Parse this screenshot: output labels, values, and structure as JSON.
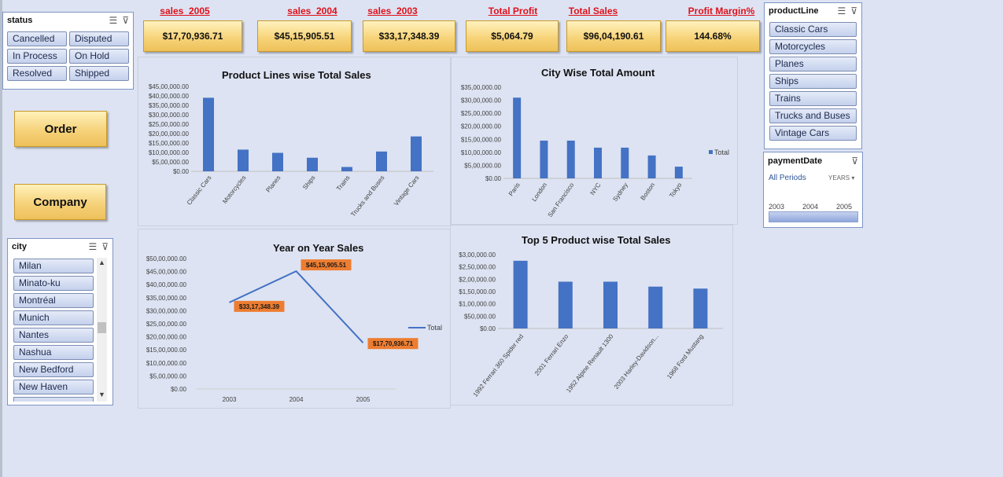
{
  "kpis": [
    {
      "label": "sales_2005",
      "value": "$17,70,936.71"
    },
    {
      "label": "sales_2004",
      "value": "$45,15,905.51"
    },
    {
      "label": "sales_2003",
      "value": "$33,17,348.39"
    },
    {
      "label": "Total Profit",
      "value": "$5,064.79"
    },
    {
      "label": "Total Sales",
      "value": "$96,04,190.61"
    },
    {
      "label": "Profit Margin%",
      "value": "144.68%"
    }
  ],
  "status_slicer": {
    "title": "status",
    "items": [
      "Cancelled",
      "Disputed",
      "In Process",
      "On Hold",
      "Resolved",
      "Shipped"
    ]
  },
  "buttons": {
    "order": "Order",
    "company": "Company"
  },
  "city_slicer": {
    "title": "city",
    "items": [
      "Milan",
      "Minato-ku",
      "Montréal",
      "Munich",
      "Nantes",
      "Nashua",
      "New Bedford",
      "New Haven"
    ]
  },
  "productline_slicer": {
    "title": "productLine",
    "items": [
      "Classic Cars",
      "Motorcycles",
      "Planes",
      "Ships",
      "Trains",
      "Trucks and Buses",
      "Vintage Cars"
    ]
  },
  "timeline": {
    "title": "paymentDate",
    "period_label": "All Periods",
    "level": "YEARS",
    "years": [
      "2003",
      "2004",
      "2005"
    ]
  },
  "chart_data": [
    {
      "type": "bar",
      "title": "Product Lines wise Total Sales",
      "categories": [
        "Classic Cars",
        "Motorcycles",
        "Planes",
        "Ships",
        "Trains",
        "Trucks and Buses",
        "Vintage Cars"
      ],
      "values": [
        3900000,
        1150000,
        980000,
        720000,
        230000,
        1050000,
        1850000
      ],
      "ylim": [
        0,
        4500000
      ],
      "yticks": [
        "$0.00",
        "$5,00,000.00",
        "$10,00,000.00",
        "$15,00,000.00",
        "$20,00,000.00",
        "$25,00,000.00",
        "$30,00,000.00",
        "$35,00,000.00",
        "$40,00,000.00",
        "$45,00,000.00"
      ],
      "color": "#4472c4"
    },
    {
      "type": "bar",
      "title": "City Wise Total Amount",
      "categories": [
        "Paris",
        "London",
        "San Francisco",
        "NYC",
        "Sydney",
        "Boston",
        "Tokyo"
      ],
      "values": [
        3100000,
        1450000,
        1450000,
        1180000,
        1180000,
        880000,
        450000
      ],
      "ylim": [
        0,
        3500000
      ],
      "yticks": [
        "$0.00",
        "$5,00,000.00",
        "$10,00,000.00",
        "$15,00,000.00",
        "$20,00,000.00",
        "$25,00,000.00",
        "$30,00,000.00",
        "$35,00,000.00"
      ],
      "legend": "Total",
      "legend_position": "right",
      "color": "#4472c4"
    },
    {
      "type": "line",
      "title": "Year on Year Sales",
      "categories": [
        "2003",
        "2004",
        "2005"
      ],
      "values": [
        3317348.39,
        4515905.51,
        1770936.71
      ],
      "data_labels": [
        "$33,17,348.39",
        "$45,15,905.51",
        "$17,70,936.71"
      ],
      "ylim": [
        0,
        5000000
      ],
      "yticks": [
        "$0.00",
        "$5,00,000.00",
        "$10,00,000.00",
        "$15,00,000.00",
        "$20,00,000.00",
        "$25,00,000.00",
        "$30,00,000.00",
        "$35,00,000.00",
        "$40,00,000.00",
        "$45,00,000.00",
        "$50,00,000.00"
      ],
      "legend": "Total",
      "legend_position": "right",
      "color": "#4472c4",
      "label_color": "#ed7d31"
    },
    {
      "type": "bar",
      "title": "Top 5 Product wise Total Sales",
      "categories": [
        "1992 Ferrari 360 Spider red",
        "2001 Ferrari Enzo",
        "1952 Alpine Renault 1300",
        "2003 Harley-Davidson...",
        "1968 Ford Mustang"
      ],
      "values": [
        275000,
        190000,
        190000,
        170000,
        162000
      ],
      "ylim": [
        0,
        300000
      ],
      "yticks": [
        "$0.00",
        "$50,000.00",
        "$1,00,000.00",
        "$1,50,000.00",
        "$2,00,000.00",
        "$2,50,000.00",
        "$3,00,000.00"
      ],
      "color": "#4472c4"
    }
  ]
}
